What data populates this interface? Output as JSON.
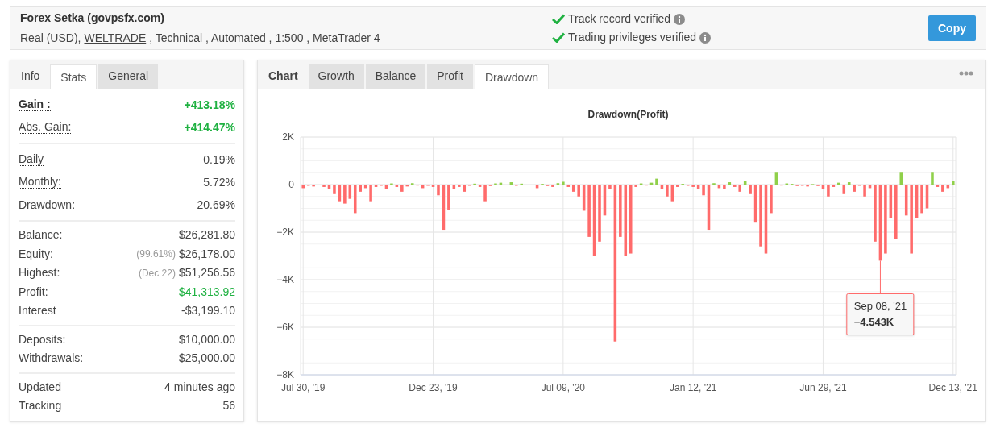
{
  "header": {
    "title": "Forex Setka (govpsfx.com)",
    "details": [
      {
        "text": "Real (USD),",
        "link": false
      },
      {
        "text": "WELTRADE",
        "link": true
      },
      {
        "text": ", Technical , Automated , 1:500 , MetaTrader 4",
        "link": false
      }
    ],
    "verifications": [
      {
        "text": "Track record verified",
        "verified": true
      },
      {
        "text": "Trading privileges verified",
        "verified": true
      }
    ],
    "copy_button": "Copy"
  },
  "stats_panel": {
    "tabs": [
      {
        "label": "Info",
        "selected": false
      },
      {
        "label": "Stats",
        "selected": true
      },
      {
        "label": "General",
        "selected": false
      }
    ],
    "groups": [
      [
        {
          "label": "Gain :",
          "value": "+413.18%",
          "positive": true,
          "bold": true,
          "hint": true
        },
        {
          "label": "Abs. Gain:",
          "value": "+414.47%",
          "positive": true,
          "bold": false,
          "hint": true
        }
      ],
      [
        {
          "label": "Daily",
          "value": "0.19%",
          "positive": false,
          "bold": false,
          "hint": true
        },
        {
          "label": "Monthly:",
          "value": "5.72%",
          "positive": false,
          "bold": false,
          "hint": true
        },
        {
          "label": "Drawdown:",
          "value": "20.69%",
          "positive": false,
          "bold": false,
          "hint": false
        }
      ],
      [
        {
          "label": "Balance:",
          "value": "$26,281.80",
          "positive": false,
          "bold": false,
          "hint": false
        },
        {
          "label": "Equity:",
          "note": "(99.61%)",
          "value": "$26,178.00",
          "positive": false,
          "bold": false,
          "hint": false
        },
        {
          "label": "Highest:",
          "note": "(Dec 22)",
          "value": "$51,256.56",
          "positive": false,
          "bold": false,
          "hint": false
        },
        {
          "label": "Profit:",
          "value": "$41,313.92",
          "positive": true,
          "bold": false,
          "hint": false
        },
        {
          "label": "Interest",
          "value": "-$3,199.10",
          "positive": false,
          "bold": false,
          "hint": false
        }
      ],
      [
        {
          "label": "Deposits:",
          "value": "$10,000.00",
          "positive": false,
          "bold": false,
          "hint": false
        },
        {
          "label": "Withdrawals:",
          "value": "$25,000.00",
          "positive": false,
          "bold": false,
          "hint": false
        }
      ],
      [
        {
          "label": "Updated",
          "value": "4 minutes ago",
          "positive": false,
          "bold": false,
          "hint": false
        },
        {
          "label": "Tracking",
          "value": "56",
          "positive": false,
          "bold": false,
          "hint": false
        }
      ]
    ]
  },
  "chart_panel": {
    "heading": "Chart",
    "tabs": [
      {
        "label": "Growth",
        "selected": false
      },
      {
        "label": "Balance",
        "selected": false
      },
      {
        "label": "Profit",
        "selected": false
      },
      {
        "label": "Drawdown",
        "selected": true
      }
    ],
    "chart_data": {
      "type": "bar",
      "title": "Drawdown(Profit)",
      "grid": true,
      "ylim": [
        -8000,
        2000
      ],
      "categories": [
        "Jul 30, '19",
        null,
        null,
        null,
        null,
        null,
        null,
        null,
        null,
        null,
        null,
        null,
        null,
        null,
        null,
        null,
        null,
        null,
        null,
        null,
        null,
        null,
        null,
        null,
        null,
        "Dec 23, '19",
        null,
        null,
        null,
        null,
        null,
        null,
        null,
        null,
        null,
        null,
        null,
        null,
        null,
        null,
        null,
        null,
        null,
        null,
        null,
        null,
        null,
        null,
        null,
        null,
        "Jul 09, '20",
        null,
        null,
        null,
        null,
        null,
        null,
        null,
        null,
        null,
        null,
        null,
        null,
        null,
        null,
        null,
        null,
        null,
        null,
        null,
        null,
        null,
        null,
        null,
        null,
        "Jan 12, '21",
        null,
        null,
        null,
        null,
        null,
        null,
        null,
        null,
        null,
        null,
        null,
        null,
        null,
        null,
        null,
        null,
        null,
        null,
        null,
        null,
        null,
        null,
        null,
        null,
        "Jun 29, '21",
        null,
        null,
        null,
        null,
        null,
        null,
        null,
        null,
        null,
        null,
        null,
        null,
        null,
        null,
        null,
        null,
        null,
        null,
        null,
        null,
        null,
        null,
        null,
        null,
        "Dec 13, '21"
      ],
      "yticks": [
        {
          "value": 2000,
          "label": "2K"
        },
        {
          "value": 0,
          "label": "0"
        },
        {
          "value": -2000,
          "label": "−2K"
        },
        {
          "value": -4000,
          "label": "−4K"
        },
        {
          "value": -6000,
          "label": "−6K"
        },
        {
          "value": -8000,
          "label": "−8K"
        }
      ],
      "series": [
        {
          "color": "#ff6b6b",
          "values": [
            -150,
            -50,
            -80,
            -30,
            -100,
            -200,
            -400,
            -700,
            -800,
            -600,
            -1200,
            -300,
            -150,
            -700,
            -100,
            -50,
            -200,
            null,
            -100,
            -300,
            -80,
            null,
            -40,
            -150,
            -50,
            -100,
            -450,
            -1900,
            -1050,
            -200,
            -100,
            -300,
            -50,
            null,
            -100,
            -700,
            -60,
            null,
            null,
            -30,
            null,
            -50,
            null,
            -20,
            -30,
            -150,
            null,
            -60,
            -100,
            null,
            null,
            -100,
            -300,
            -500,
            -1100,
            -2200,
            -3000,
            -2400,
            -1300,
            -200,
            -6600,
            -2200,
            -3000,
            -2900,
            -100,
            null,
            -40,
            null,
            null,
            -200,
            -500,
            -700,
            -100,
            null,
            -50,
            -100,
            -200,
            -450,
            -1900,
            null,
            -150,
            -200,
            null,
            -100,
            -300,
            null,
            -400,
            -1600,
            -2600,
            -2900,
            -1200,
            null,
            -40,
            null,
            null,
            -60,
            -50,
            -80,
            null,
            -60,
            -200,
            -500,
            -100,
            null,
            -400,
            null,
            -300,
            -50,
            -500,
            -150,
            -2400,
            -3200,
            -2900,
            -1400,
            -2300,
            null,
            -1300,
            -2900,
            -1400,
            -1200,
            -1000,
            null,
            -100,
            -300,
            -150,
            null
          ]
        },
        {
          "color": "#90d04a",
          "values": [
            null,
            null,
            null,
            null,
            null,
            null,
            null,
            null,
            null,
            null,
            null,
            null,
            null,
            null,
            null,
            null,
            null,
            50,
            null,
            null,
            null,
            60,
            null,
            null,
            null,
            null,
            null,
            null,
            null,
            null,
            null,
            null,
            null,
            40,
            null,
            null,
            null,
            50,
            80,
            null,
            100,
            null,
            40,
            null,
            null,
            null,
            30,
            null,
            null,
            60,
            120,
            null,
            null,
            null,
            null,
            null,
            null,
            null,
            null,
            null,
            null,
            null,
            null,
            null,
            null,
            50,
            null,
            80,
            250,
            null,
            null,
            null,
            null,
            30,
            null,
            null,
            null,
            null,
            null,
            60,
            null,
            null,
            100,
            null,
            null,
            150,
            null,
            null,
            null,
            null,
            null,
            500,
            null,
            50,
            30,
            null,
            null,
            null,
            20,
            null,
            null,
            null,
            null,
            80,
            null,
            100,
            null,
            null,
            null,
            null,
            null,
            null,
            null,
            null,
            null,
            500,
            null,
            null,
            null,
            null,
            null,
            500,
            null,
            null,
            null,
            150
          ]
        }
      ],
      "annotations": [
        {
          "y": -3200,
          "text": "Sep 08, '21\n−4.543K"
        }
      ]
    }
  }
}
